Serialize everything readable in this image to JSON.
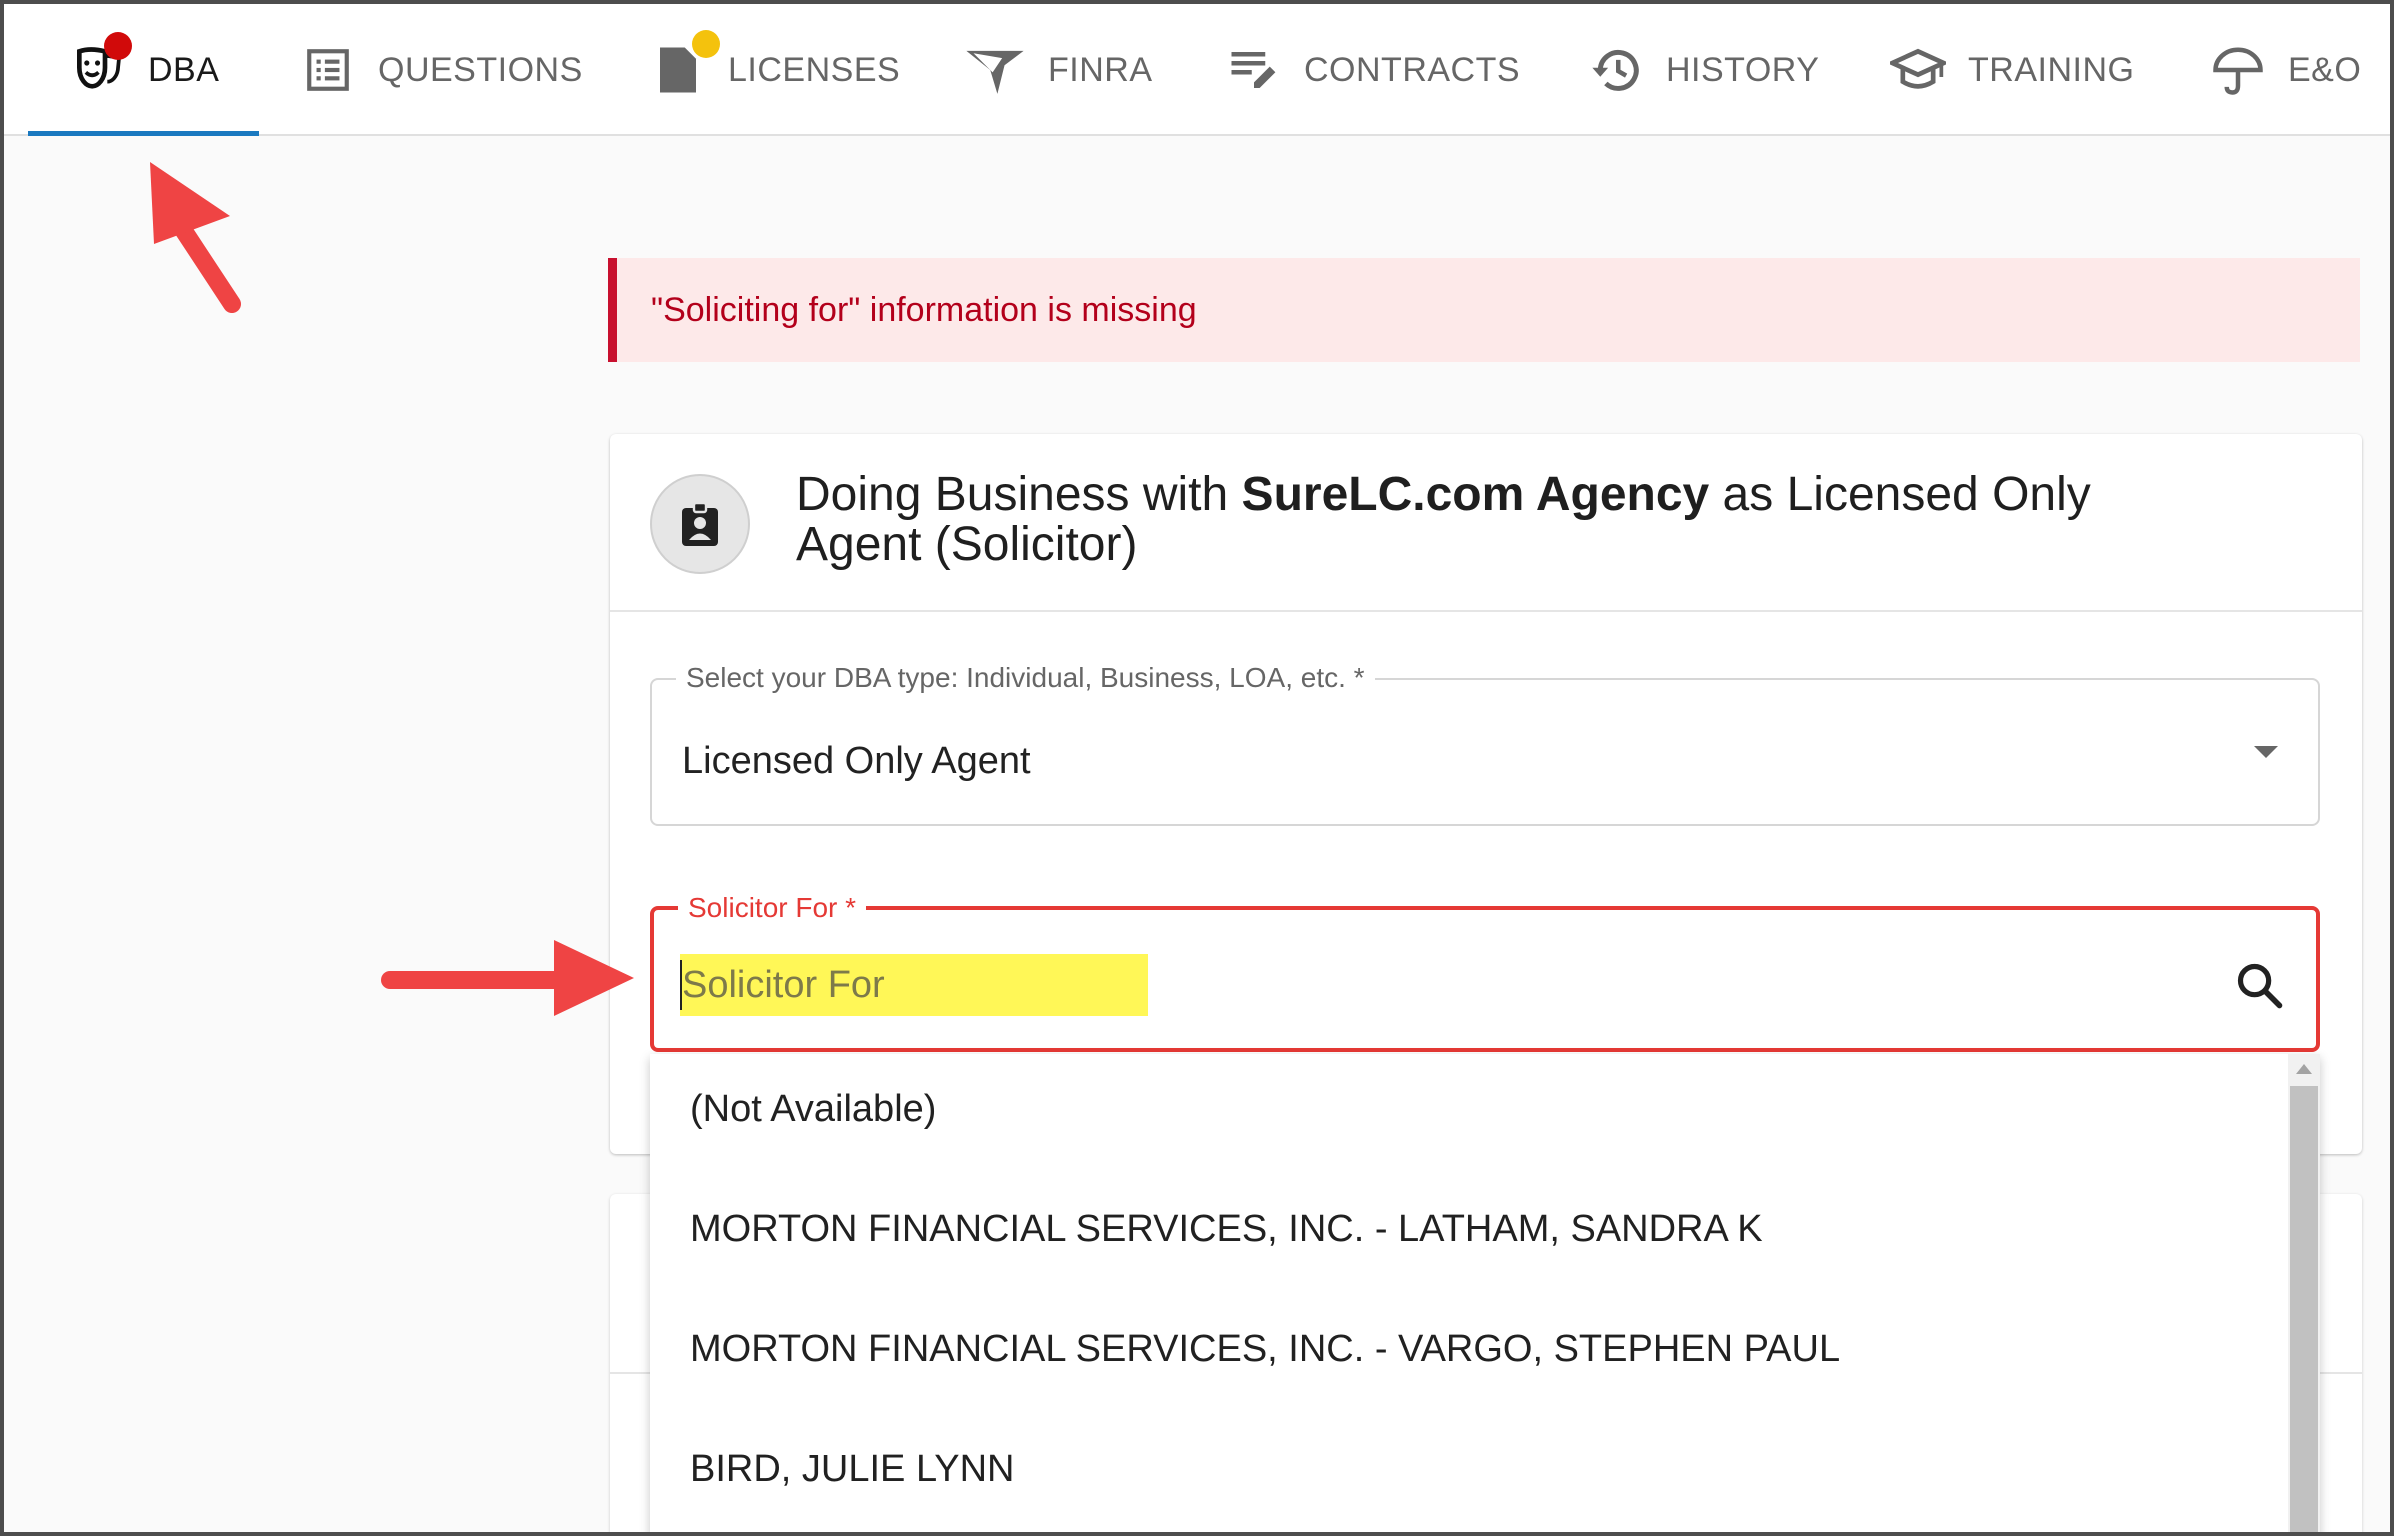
{
  "tabs": [
    {
      "label": "DBA",
      "icon": "theater-mask-icon",
      "active": true,
      "badge": "red"
    },
    {
      "label": "QUESTIONS",
      "icon": "list-icon"
    },
    {
      "label": "LICENSES",
      "icon": "document-icon",
      "badge": "yellow"
    },
    {
      "label": "FINRA",
      "icon": "finra-logo-icon"
    },
    {
      "label": "CONTRACTS",
      "icon": "edit-list-icon"
    },
    {
      "label": "HISTORY",
      "icon": "history-icon"
    },
    {
      "label": "TRAINING",
      "icon": "graduation-cap-icon"
    },
    {
      "label": "E&O",
      "icon": "umbrella-icon"
    }
  ],
  "alert": {
    "message": "\"Soliciting for\" information is missing",
    "color": "#b3001b"
  },
  "card": {
    "title_prefix": "Doing Business with ",
    "title_bold": "SureLC.com Agency",
    "title_suffix": " as Licensed Only Agent (Solicitor)",
    "avatar_icon": "id-badge-icon"
  },
  "dba_type": {
    "label": "Select your DBA type: Individual, Business, LOA, etc. *",
    "value": "Licensed Only Agent"
  },
  "solicitor": {
    "label": "Solicitor For *",
    "placeholder": "Solicitor For",
    "value": ""
  },
  "options": [
    "(Not Available)",
    "MORTON FINANCIAL SERVICES, INC. - LATHAM, SANDRA K",
    "MORTON FINANCIAL SERVICES, INC. - VARGO, STEPHEN PAUL",
    "BIRD, JULIE LYNN"
  ],
  "colors": {
    "accent": "#1a79c0",
    "error": "#e53935",
    "highlight": "#fff757",
    "annotation_arrow": "#ef4444"
  }
}
